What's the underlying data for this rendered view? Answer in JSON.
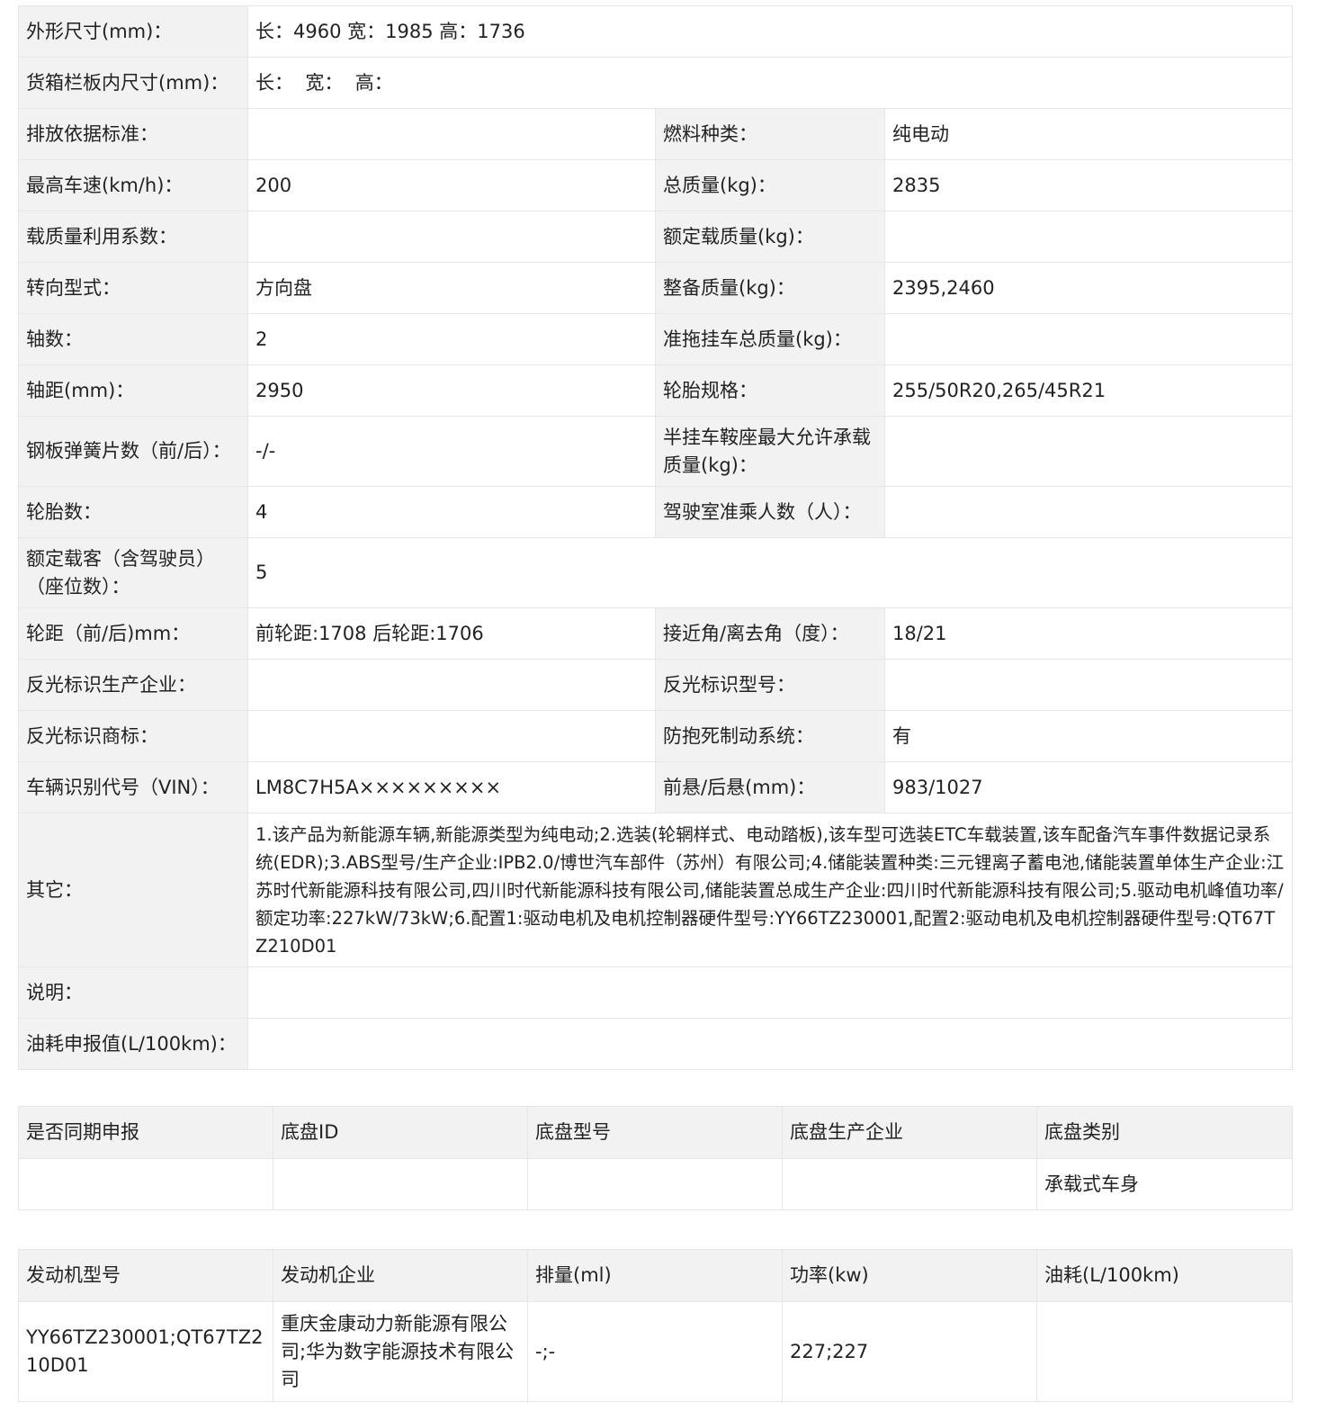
{
  "spec": {
    "dimensions_label": "外形尺寸(mm)：",
    "dimensions_value": "长：4960 宽：1985 高：1736",
    "cargo_label": "货箱栏板内尺寸(mm)：",
    "cargo_value": "长：  宽：  高：",
    "emission_label": "排放依据标准：",
    "emission_value": "",
    "fuel_label": "燃料种类：",
    "fuel_value": "纯电动",
    "speed_label": "最高车速(km/h)：",
    "speed_value": "200",
    "total_mass_label": "总质量(kg)：",
    "total_mass_value": "2835",
    "load_coef_label": "载质量利用系数：",
    "load_coef_value": "",
    "rated_load_label": "额定载质量(kg)：",
    "rated_load_value": "",
    "steering_label": "转向型式：",
    "steering_value": "方向盘",
    "curb_label": "整备质量(kg)：",
    "curb_value": "2395,2460",
    "axles_label": "轴数：",
    "axles_value": "2",
    "trailer_label": "准拖挂车总质量(kg)：",
    "trailer_value": "",
    "wheelbase_label": "轴距(mm)：",
    "wheelbase_value": "2950",
    "tire_spec_label": "轮胎规格：",
    "tire_spec_value": "255/50R20,265/45R21",
    "spring_label": "钢板弹簧片数（前/后）：",
    "spring_value": "-/-",
    "saddle_label": "半挂车鞍座最大允许承载质量(kg)：",
    "saddle_value": "",
    "tires_label": "轮胎数：",
    "tires_value": "4",
    "cab_label": "驾驶室准乘人数（人）：",
    "cab_value": "",
    "seats_label": "额定载客（含驾驶员）（座位数）：",
    "seats_value": "5",
    "track_label": "轮距（前/后)mm：",
    "track_value": "前轮距:1708 后轮距:1706",
    "angle_label": "接近角/离去角（度）：",
    "angle_value": "18/21",
    "reflect_mfr_label": "反光标识生产企业：",
    "reflect_mfr_value": "",
    "reflect_model_label": "反光标识型号：",
    "reflect_model_value": "",
    "reflect_brand_label": "反光标识商标：",
    "reflect_brand_value": "",
    "abs_label": "防抱死制动系统：",
    "abs_value": "有",
    "vin_label": "车辆识别代号（VIN）：",
    "vin_value": "LM8C7H5A×××××××××",
    "overhang_label": "前悬/后悬(mm)：",
    "overhang_value": "983/1027",
    "other_label": "其它：",
    "other_value": "1.该产品为新能源车辆,新能源类型为纯电动;2.选装(轮辋样式、电动踏板),该车型可选装ETC车载装置,该车配备汽车事件数据记录系统(EDR);3.ABS型号/生产企业:IPB2.0/博世汽车部件（苏州）有限公司;4.储能装置种类:三元锂离子蓄电池,储能装置单体生产企业:江苏时代新能源科技有限公司,四川时代新能源科技有限公司,储能装置总成生产企业:四川时代新能源科技有限公司;5.驱动电机峰值功率/额定功率:227kW/73kW;6.配置1:驱动电机及电机控制器硬件型号:YY66TZ230001,配置2:驱动电机及电机控制器硬件型号:QT67TZ210D01",
    "note_label": "说明：",
    "note_value": "",
    "fuel_cons_label": "油耗申报值(L/100km)：",
    "fuel_cons_value": ""
  },
  "chassis": {
    "headers": [
      "是否同期申报",
      "底盘ID",
      "底盘型号",
      "底盘生产企业",
      "底盘类别"
    ],
    "row": [
      "",
      "",
      "",
      "",
      "承载式车身"
    ]
  },
  "engine": {
    "headers": [
      "发动机型号",
      "发动机企业",
      "排量(ml)",
      "功率(kw)",
      "油耗(L/100km)"
    ],
    "row": [
      "YY66TZ230001;QT67TZ210D01",
      "重庆金康动力新能源有限公司;华为数字能源技术有限公司",
      "-;-",
      "227;227",
      ""
    ]
  }
}
